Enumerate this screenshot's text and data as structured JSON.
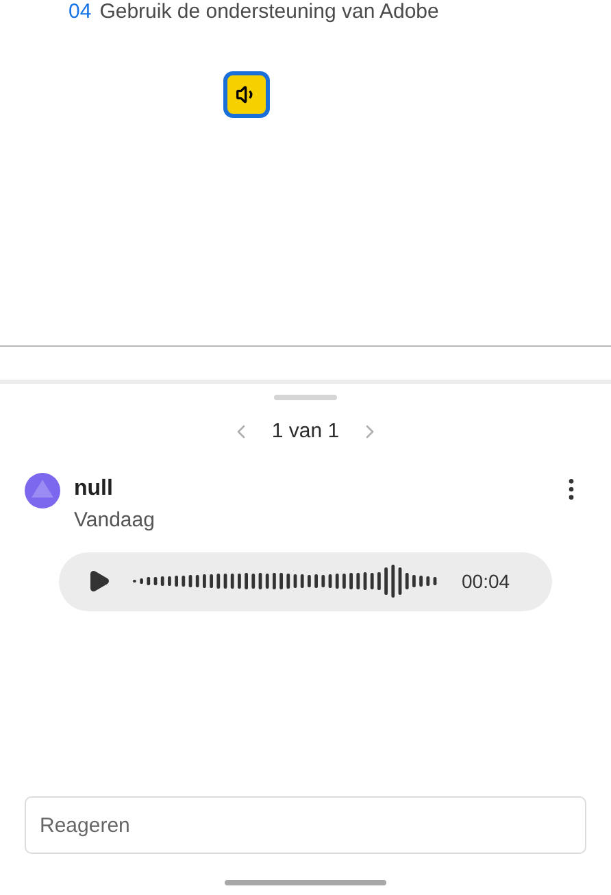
{
  "document": {
    "step_number": "04",
    "step_text": "Gebruik de ondersteuning van Adobe"
  },
  "panel": {
    "pager": "1 van 1"
  },
  "comment": {
    "author": "null",
    "date": "Vandaag",
    "audio": {
      "duration": "00:04"
    }
  },
  "reply": {
    "placeholder": "Reageren"
  }
}
